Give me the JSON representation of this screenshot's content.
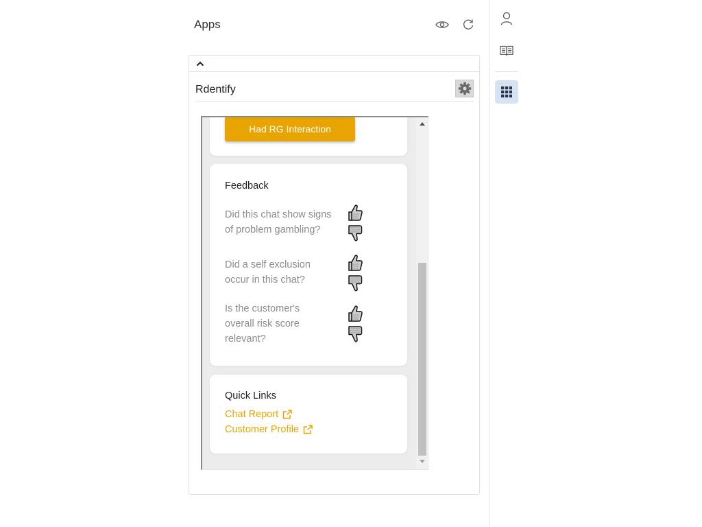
{
  "header": {
    "title": "Apps",
    "icons": [
      "eye-icon",
      "refresh-icon"
    ]
  },
  "app": {
    "name": "Rdentify",
    "collapse_icon": "chevron-up-icon",
    "settings_icon": "gear-icon"
  },
  "actions": {
    "rg_button_label": "Had RG Interaction"
  },
  "feedback": {
    "title": "Feedback",
    "questions": [
      {
        "line1": "Did this chat show signs",
        "line2": "of problem gambling?"
      },
      {
        "line1": "Did a self exclusion",
        "line2": "occur in this chat?"
      },
      {
        "line1": "Is the customer's",
        "line2": "overall risk score",
        "line3": "relevant?"
      }
    ],
    "icons": [
      "thumbs-up-icon",
      "thumbs-down-icon"
    ]
  },
  "quick_links": {
    "title": "Quick Links",
    "links": [
      {
        "label": "Chat Report",
        "icon": "external-link-icon"
      },
      {
        "label": "Customer Profile",
        "icon": "external-link-icon"
      }
    ]
  },
  "sidebar": {
    "items": [
      "user-icon",
      "book-icon",
      "apps-grid-icon"
    ],
    "active": "apps-grid-icon"
  },
  "colors": {
    "accent": "#e8a400",
    "sidebar_active": "#d7e3f3",
    "muted_text": "#8d8d8d"
  }
}
